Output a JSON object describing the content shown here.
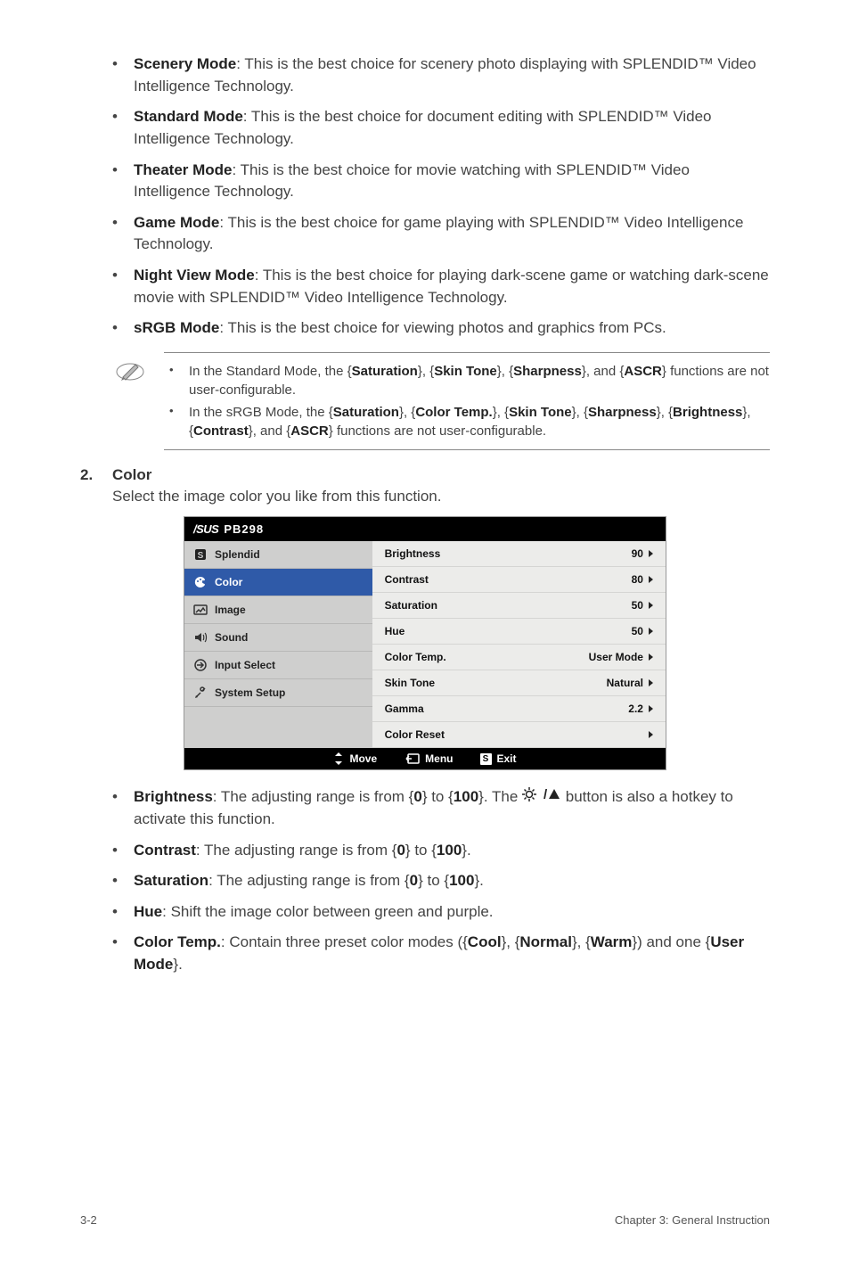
{
  "modes": [
    {
      "name": "Scenery Mode",
      "desc": ": This is the best choice for scenery photo displaying with SPLENDID™ Video Intelligence Technology."
    },
    {
      "name": "Standard Mode",
      "desc": ": This is the best choice for document editing with SPLENDID™ Video Intelligence Technology."
    },
    {
      "name": "Theater Mode",
      "desc": ": This is the best choice for movie watching with SPLENDID™ Video Intelligence Technology."
    },
    {
      "name": "Game Mode",
      "desc": ": This is the best choice for game playing with SPLENDID™ Video Intelligence Technology."
    },
    {
      "name": "Night View Mode",
      "desc": ": This is the best choice for playing dark-scene game or watching dark-scene movie with SPLENDID™ Video Intelligence Technology."
    },
    {
      "name": "sRGB Mode",
      "desc": ": This is the best choice for viewing photos and graphics from PCs."
    }
  ],
  "notes": {
    "0": {
      "pre": "In the Standard Mode, the {",
      "b1": "Saturation",
      "m1": "}, {",
      "b2": "Skin Tone",
      "m2": "}, {",
      "b3": "Sharpness",
      "m3": "}, and {",
      "b4": "ASCR",
      "post": "} functions are not user-configurable."
    },
    "1": {
      "pre": "In the sRGB Mode, the {",
      "b1": "Saturation",
      "m1": "}, {",
      "b2": "Color Temp.",
      "m2": "}, {",
      "b3": "Skin Tone",
      "m3": "}, {",
      "b4": "Sharpness",
      "m4": "}, {",
      "b5": "Brightness",
      "m5": "}, {",
      "b6": "Contrast",
      "m6": "}, and {",
      "b7": "ASCR",
      "post": "} functions are not user-configurable."
    }
  },
  "section": {
    "num": "2.",
    "title": "Color",
    "desc": "Select the image color you like from this function."
  },
  "osd": {
    "brand": "/SUS",
    "model": "PB298",
    "nav": {
      "0": "Splendid",
      "1": "Color",
      "2": "Image",
      "3": "Sound",
      "4": "Input Select",
      "5": "System Setup"
    },
    "rows": {
      "0": {
        "label": "Brightness",
        "val": "90"
      },
      "1": {
        "label": "Contrast",
        "val": "80"
      },
      "2": {
        "label": "Saturation",
        "val": "50"
      },
      "3": {
        "label": "Hue",
        "val": "50"
      },
      "4": {
        "label": "Color Temp.",
        "val": "User Mode"
      },
      "5": {
        "label": "Skin Tone",
        "val": "Natural"
      },
      "6": {
        "label": "Gamma",
        "val": "2.2"
      },
      "7": {
        "label": "Color Reset",
        "val": ""
      }
    },
    "footer": {
      "move": "Move",
      "menu": "Menu",
      "exit_s": "S",
      "exit": "Exit"
    }
  },
  "params": {
    "brightness": {
      "name": "Brightness",
      "t1": ": The adjusting range is from {",
      "v0": "0",
      "t2": "} to {",
      "v1": "100",
      "t3": "}. The ",
      "t4": " button is also a hotkey to activate this function."
    },
    "contrast": {
      "name": "Contrast",
      "t1": ": The adjusting range is from {",
      "v0": "0",
      "t2": "} to {",
      "v1": "100",
      "t3": "}."
    },
    "saturation": {
      "name": "Saturation",
      "t1": ": The adjusting range is from {",
      "v0": "0",
      "t2": "} to {",
      "v1": "100",
      "t3": "}."
    },
    "hue": {
      "name": "Hue",
      "desc": ": Shift the image color between green and purple."
    },
    "colortemp": {
      "name": "Color Temp.",
      "t1": ": Contain three preset color modes ({",
      "v1": "Cool",
      "t2": "}, {",
      "v2": "Normal",
      "t3": "}, {",
      "v3": "Warm",
      "t4": "}) and one {",
      "v4": "User Mode",
      "t5": "}."
    }
  },
  "footer": {
    "left": "3-2",
    "right": "Chapter 3: General Instruction"
  }
}
